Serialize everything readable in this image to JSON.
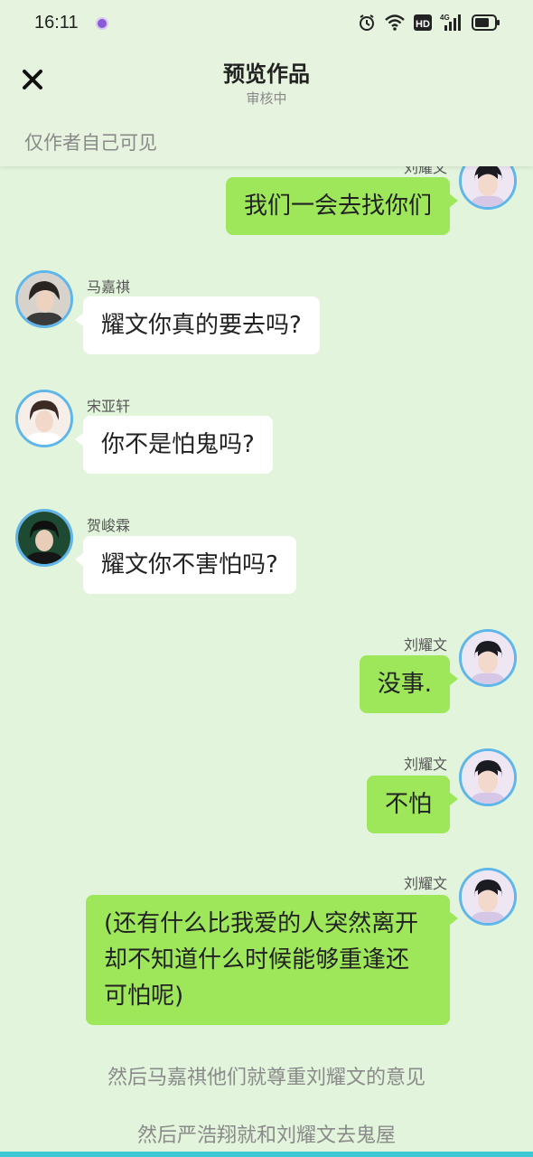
{
  "status_bar": {
    "time": "16:11",
    "hd_label": "HD",
    "network_label": "4G"
  },
  "header": {
    "title": "预览作品",
    "subtitle": "审核中",
    "visibility_note": "仅作者自己可见"
  },
  "messages": [
    {
      "side": "right",
      "name": "刘耀文",
      "text": "我们一会去找你们"
    },
    {
      "side": "left",
      "name": "马嘉祺",
      "text": "耀文你真的要去吗?"
    },
    {
      "side": "left",
      "name": "宋亚轩",
      "text": "你不是怕鬼吗?"
    },
    {
      "side": "left",
      "name": "贺峻霖",
      "text": "耀文你不害怕吗?"
    },
    {
      "side": "right",
      "name": "刘耀文",
      "text": "没事."
    },
    {
      "side": "right",
      "name": "刘耀文",
      "text": "不怕"
    },
    {
      "side": "right",
      "name": "刘耀文",
      "text": "(还有什么比我爱的人突然离开却不知道什么时候能够重逢还可怕呢)"
    }
  ],
  "narrations": [
    "然后马嘉祺他们就尊重刘耀文的意见",
    "然后严浩翔就和刘耀文去鬼屋"
  ],
  "colors": {
    "background": "#e3f4dc",
    "bubble_right": "#9ee75a",
    "bubble_left": "#ffffff",
    "avatar_ring": "#5fb6ea"
  }
}
